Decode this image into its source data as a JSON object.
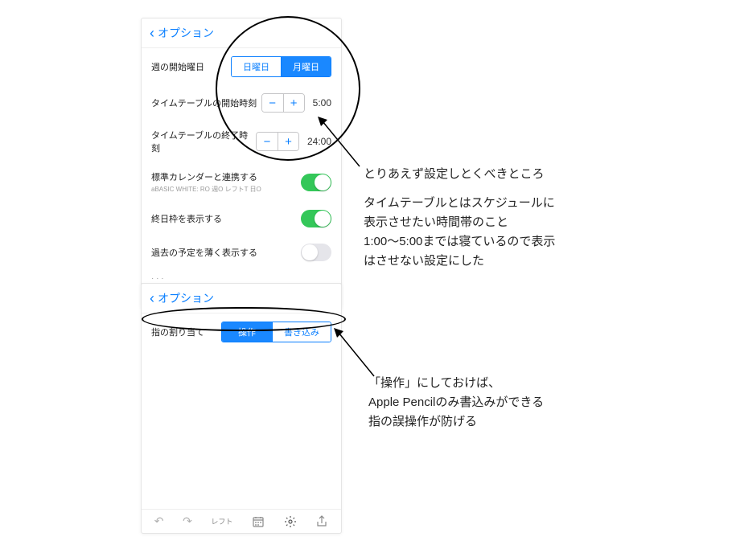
{
  "panel1": {
    "back_label": "オプション",
    "rows": {
      "week_start": {
        "label": "週の開始曜日",
        "opt_a": "日曜日",
        "opt_b": "月曜日",
        "selected": "b"
      },
      "tt_start": {
        "label": "タイムテーブルの開始時刻",
        "value": "5:00"
      },
      "tt_end": {
        "label": "タイムテーブルの終了時刻",
        "value": "24:00"
      },
      "link_cal": {
        "label": "標準カレンダーと連携する",
        "sub": "aBASIC WHITE: RO 週O レフトT 日O",
        "on": true
      },
      "show_holiday": {
        "label": "終日枠を表示する",
        "on": true
      },
      "dim_past": {
        "label": "過去の予定を薄く表示する",
        "on": false
      }
    },
    "toolbar": {
      "left_label": "レフト"
    }
  },
  "panel2": {
    "back_label": "オプション",
    "rows": {
      "finger": {
        "label": "指の割り当て",
        "opt_a": "操作",
        "opt_b": "書き込み",
        "selected": "a"
      }
    },
    "toolbar": {
      "left_label": "レフト"
    }
  },
  "annotations": {
    "note1_line1": "とりあえず設定しとくべきところ",
    "note1_line2": "タイムテーブルとはスケジュールに",
    "note1_line3": "表示させたい時間帯のこと",
    "note1_line4": "1:00〜5:00までは寝ているので表示",
    "note1_line5": "はさせない設定にした",
    "note2_line1": "「操作」にしておけば、",
    "note2_line2": "Apple Pencilのみ書込みができる",
    "note2_line3": "指の誤操作が防げる"
  }
}
